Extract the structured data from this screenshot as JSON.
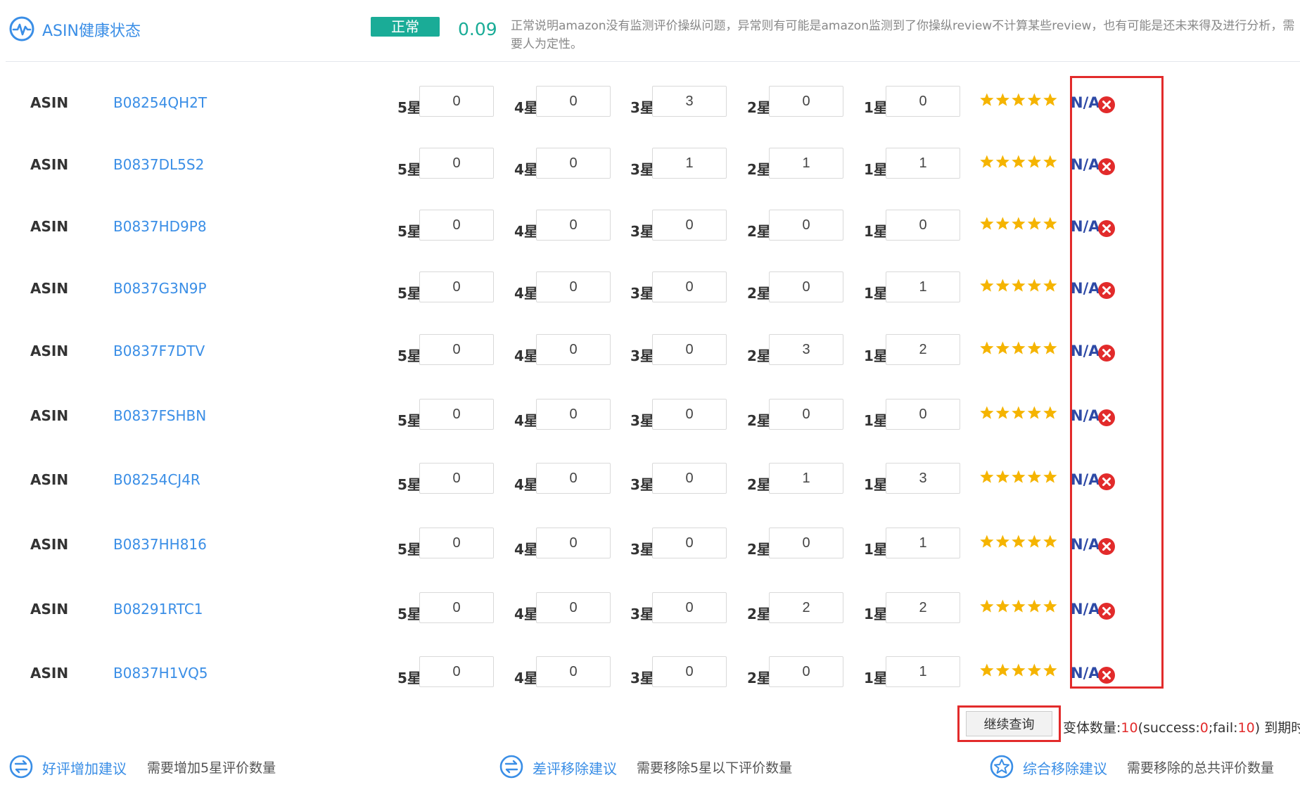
{
  "header": {
    "title": "ASIN健康状态",
    "status": "正常",
    "score": "0.09",
    "description": "正常说明amazon没有监测评价操纵问题，异常则有可能是amazon监测到了你操纵review不计算某些review，也有可能是还未来得及进行分析，需要人为定性。"
  },
  "star_labels": [
    "5星",
    "4星",
    "3星",
    "2星",
    "1星"
  ],
  "asin_label": "ASIN",
  "na_text": "N/A",
  "rows": [
    {
      "asin": "B08254QH2T",
      "counts": [
        "0",
        "0",
        "3",
        "0",
        "0"
      ]
    },
    {
      "asin": "B0837DL5S2",
      "counts": [
        "0",
        "0",
        "1",
        "1",
        "1"
      ]
    },
    {
      "asin": "B0837HD9P8",
      "counts": [
        "0",
        "0",
        "0",
        "0",
        "0"
      ]
    },
    {
      "asin": "B0837G3N9P",
      "counts": [
        "0",
        "0",
        "0",
        "0",
        "1"
      ]
    },
    {
      "asin": "B0837F7DTV",
      "counts": [
        "0",
        "0",
        "0",
        "3",
        "2"
      ]
    },
    {
      "asin": "B0837FSHBN",
      "counts": [
        "0",
        "0",
        "0",
        "0",
        "0"
      ]
    },
    {
      "asin": "B08254CJ4R",
      "counts": [
        "0",
        "0",
        "0",
        "1",
        "3"
      ]
    },
    {
      "asin": "B0837HH816",
      "counts": [
        "0",
        "0",
        "0",
        "0",
        "1"
      ]
    },
    {
      "asin": "B08291RTC1",
      "counts": [
        "0",
        "0",
        "0",
        "2",
        "2"
      ]
    },
    {
      "asin": "B0837H1VQ5",
      "counts": [
        "0",
        "0",
        "0",
        "0",
        "1"
      ]
    }
  ],
  "rating_stars": 5,
  "continue_button": "继续查询",
  "variant": {
    "label": "变体数量:",
    "total": "10",
    "open": "(success:",
    "success": "0",
    "sep": ";fail:",
    "fail": "10",
    "close": ")",
    "expiry_label": "到期时间"
  },
  "suggestions": [
    {
      "title": "好评增加建议",
      "desc": "需要增加5星评价数量",
      "icon": "arrows-icon"
    },
    {
      "title": "差评移除建议",
      "desc": "需要移除5星以下评价数量",
      "icon": "arrows-icon"
    },
    {
      "title": "综合移除建议",
      "desc": "需要移除的总共评价数量",
      "icon": "star-circle-icon"
    }
  ],
  "colors": {
    "accent": "#3a8ee6",
    "status_green": "#1aac97",
    "highlight_red": "#e22b2b",
    "star_gold": "#f5b400"
  }
}
